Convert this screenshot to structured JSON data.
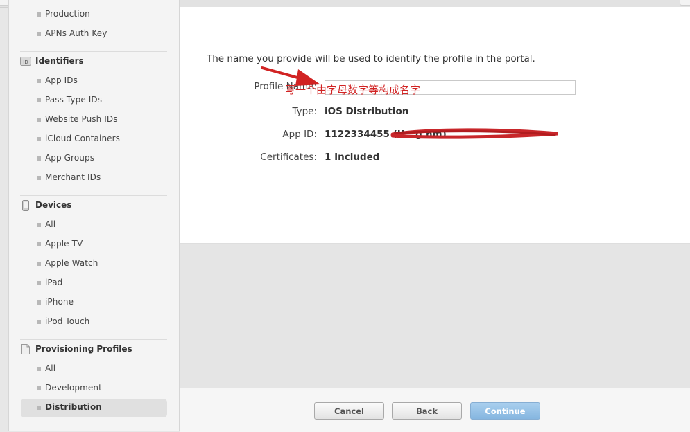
{
  "sidebar": {
    "certificates_items": [
      "Production",
      "APNs Auth Key"
    ],
    "identifiers": {
      "title": "Identifiers",
      "icon": "id-badge-icon",
      "items": [
        "App IDs",
        "Pass Type IDs",
        "Website Push IDs",
        "iCloud Containers",
        "App Groups",
        "Merchant IDs"
      ]
    },
    "devices": {
      "title": "Devices",
      "icon": "device-icon",
      "items": [
        "All",
        "Apple TV",
        "Apple Watch",
        "iPad",
        "iPhone",
        "iPod Touch"
      ]
    },
    "profiles": {
      "title": "Provisioning Profiles",
      "icon": "document-icon",
      "items": [
        "All",
        "Development",
        "Distribution"
      ],
      "active": "Distribution"
    },
    "id_badge_text": "ID"
  },
  "form": {
    "intro": "The name you provide will be used to identify the profile in the portal.",
    "profile_name_label": "Profile Name:",
    "profile_name_value": "",
    "type_label": "Type:",
    "type_value": "iOS Distribution",
    "app_id_label": "App ID:",
    "app_id_value": "1122334455 (U...g.hm)",
    "certificates_label": "Certificates:",
    "certificates_value": "1 Included"
  },
  "annotations": {
    "hint": "写一个由字母数字等构成名字",
    "color": "#d12323"
  },
  "buttons": {
    "cancel": "Cancel",
    "back": "Back",
    "continue": "Continue"
  },
  "colors": {
    "primary_button": "#8fbde4",
    "annotation_red": "#d12323"
  }
}
